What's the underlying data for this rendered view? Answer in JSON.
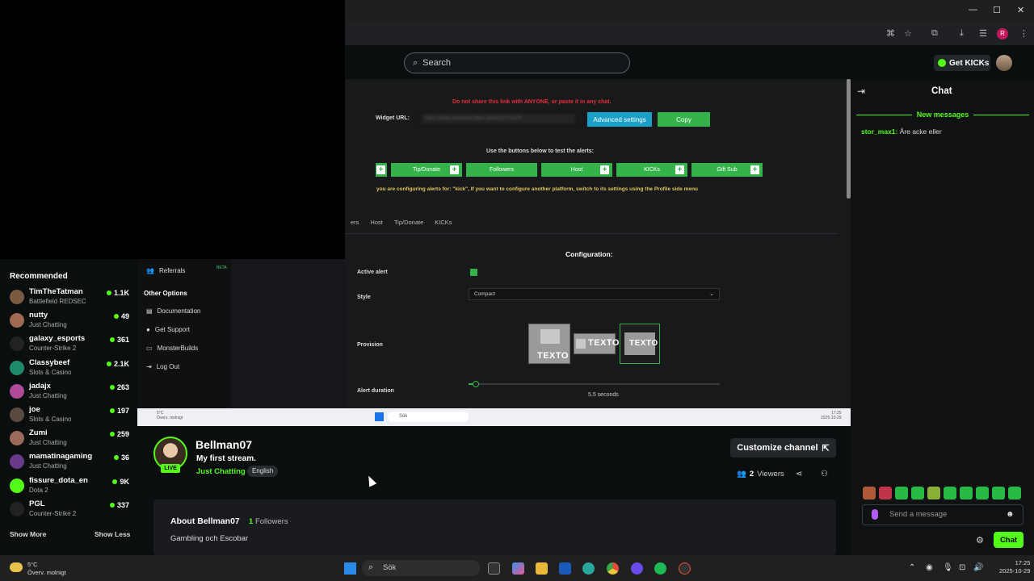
{
  "browser": {
    "window_controls": [
      "—",
      "☐",
      "✕"
    ],
    "toolbar_icons": [
      "translate-icon",
      "star-icon",
      "extensions-icon",
      "download-icon",
      "tabs-icon",
      "profile-icon",
      "more-icon"
    ],
    "profile_initial": "R"
  },
  "header": {
    "search_placeholder": "Search",
    "get_kicks_label": "Get KICKs"
  },
  "stream_overlay": {
    "warning": "Do not share this link with ANYONE, or paste it in any chat.",
    "widget_url_label": "Widget URL:",
    "widget_url_value": "https://botrix.live/alerts?bid=-84a%2FZrTse7k",
    "advanced_settings_label": "Advanced settings",
    "copy_label": "Copy",
    "test_label": "Use the buttons below to test the alerts:",
    "test_buttons": [
      "Tip/Donate",
      "Followers",
      "Host",
      "KICKs",
      "Gift Sub"
    ],
    "config_note": "you are configuring alerts for: \"kick\", If you want to configure another platform, switch to its settings using the Profile side menu",
    "tabs": [
      "ers",
      "Host",
      "Tip/Donate",
      "KICKs"
    ],
    "configuration_title": "Configuration:",
    "active_alert_label": "Active alert",
    "style_label": "Style",
    "style_value": "Compact",
    "provision_label": "Provision",
    "provision_text": "TEXTO",
    "alert_duration_label": "Alert duration",
    "alert_duration_value": "5,5 seconds",
    "alert_duration_fraction": 0.03,
    "menu": {
      "referrals": "Referrals",
      "referrals_badge": "BETA",
      "other_options": "Other Options",
      "documentation": "Documentation",
      "get_support": "Get Support",
      "monster_builds": "MonsterBuilds",
      "log_out": "Log Out"
    },
    "inner_taskbar": {
      "weather_temp": "5°C",
      "weather_desc": "Övers. molnigt",
      "search": "Sök",
      "time": "17:25",
      "date": "2025-10-29"
    }
  },
  "sidebar": {
    "title": "Recommended",
    "items": [
      {
        "name": "TimTheTatman",
        "category": "Battlefield REDSEC",
        "viewers": "1.1K",
        "color": "#7a5a43"
      },
      {
        "name": "nutty",
        "category": "Just Chatting",
        "viewers": "49",
        "color": "#a06a50"
      },
      {
        "name": "galaxy_esports",
        "category": "Counter-Strike 2",
        "viewers": "361",
        "color": "#222"
      },
      {
        "name": "Classybeef",
        "category": "Slots & Casino",
        "viewers": "2.1K",
        "color": "#1f8a6a"
      },
      {
        "name": "jadajx",
        "category": "Just Chatting",
        "viewers": "263",
        "color": "#b04a9a"
      },
      {
        "name": "joe",
        "category": "Slots & Casino",
        "viewers": "197",
        "color": "#5a4a40"
      },
      {
        "name": "Zumi",
        "category": "Just Chatting",
        "viewers": "259",
        "color": "#9a6a5a"
      },
      {
        "name": "mamatinagaming",
        "category": "Just Chatting",
        "viewers": "36",
        "color": "#6a3a8a"
      },
      {
        "name": "fissure_dota_en",
        "category": "Dota 2",
        "viewers": "9K",
        "color": "#53fc18"
      },
      {
        "name": "PGL",
        "category": "Counter-Strike 2",
        "viewers": "337",
        "color": "#222"
      }
    ],
    "show_more": "Show More",
    "show_less": "Show Less"
  },
  "channel": {
    "live_badge": "LIVE",
    "name": "Bellman07",
    "stream_title": "My first stream.",
    "category": "Just Chatting",
    "language": "English",
    "customize_label": "Customize channel",
    "viewers_count": "2",
    "viewers_label": "Viewers",
    "about_title": "About Bellman07",
    "followers_count": "1",
    "followers_label": "Followers",
    "description": "Gambling och Escobar"
  },
  "chat": {
    "title": "Chat",
    "new_messages": "New messages",
    "messages": [
      {
        "user": "stor_max1:",
        "text": "Åre acke eller"
      }
    ],
    "input_placeholder": "Send a message",
    "send_label": "Chat"
  },
  "taskbar": {
    "weather_temp": "5°C",
    "weather_desc": "Överv. molnigt",
    "search": "Sök",
    "time": "17:25",
    "date": "2025-10-29"
  }
}
